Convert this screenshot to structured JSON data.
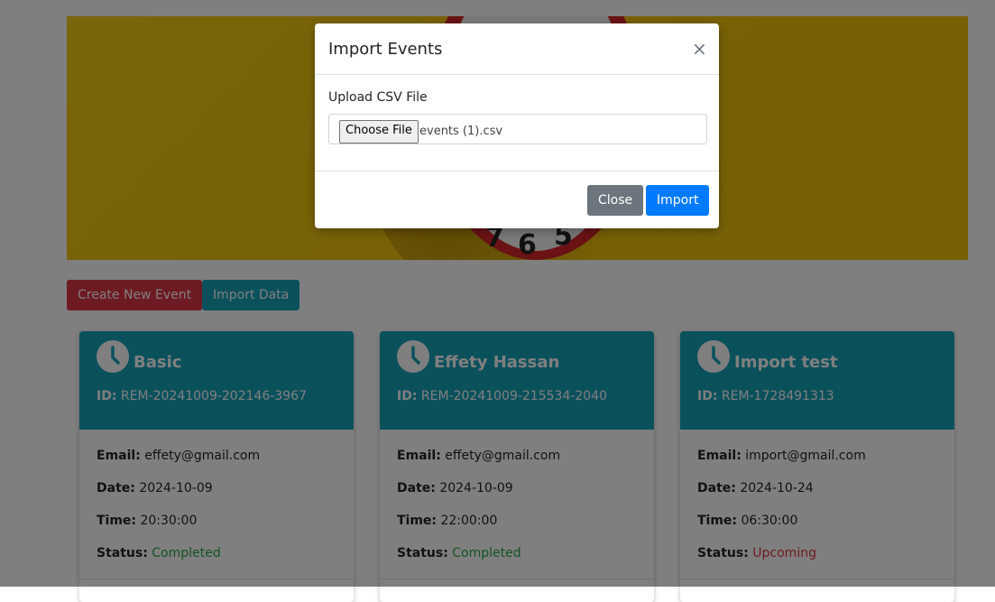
{
  "actions": {
    "create_label": "Create New Event",
    "import_label": "Import Data"
  },
  "hero": {
    "clock_numbers": [
      "7",
      "6",
      "5"
    ]
  },
  "events": [
    {
      "title": "Basic",
      "id_label": "ID:",
      "id": "REM-20241009-202146-3967",
      "email_label": "Email:",
      "email": "effety@gmail.com",
      "date_label": "Date:",
      "date": "2024-10-09",
      "time_label": "Time:",
      "time": "20:30:00",
      "status_label": "Status:",
      "status": "Completed"
    },
    {
      "title": "Effety Hassan",
      "id_label": "ID:",
      "id": "REM-20241009-215534-2040",
      "email_label": "Email:",
      "email": "effety@gmail.com",
      "date_label": "Date:",
      "date": "2024-10-09",
      "time_label": "Time:",
      "time": "22:00:00",
      "status_label": "Status:",
      "status": "Completed"
    },
    {
      "title": "Import test",
      "id_label": "ID:",
      "id": "REM-1728491313",
      "email_label": "Email:",
      "email": "import@gmail.com",
      "date_label": "Date:",
      "date": "2024-10-24",
      "time_label": "Time:",
      "time": "06:30:00",
      "status_label": "Status:",
      "status": "Upcoming"
    }
  ],
  "modal": {
    "title": "Import Events",
    "close_symbol": "×",
    "upload_label": "Upload CSV File",
    "choose_file_label": "Choose File",
    "file_name": "events (1).csv",
    "close_button": "Close",
    "import_button": "Import"
  },
  "colors": {
    "teal": "#17a2b8",
    "danger": "#dc3545",
    "primary": "#007bff",
    "secondary": "#6c757d",
    "completed": "#28a745",
    "banner": "#f0c20e"
  }
}
